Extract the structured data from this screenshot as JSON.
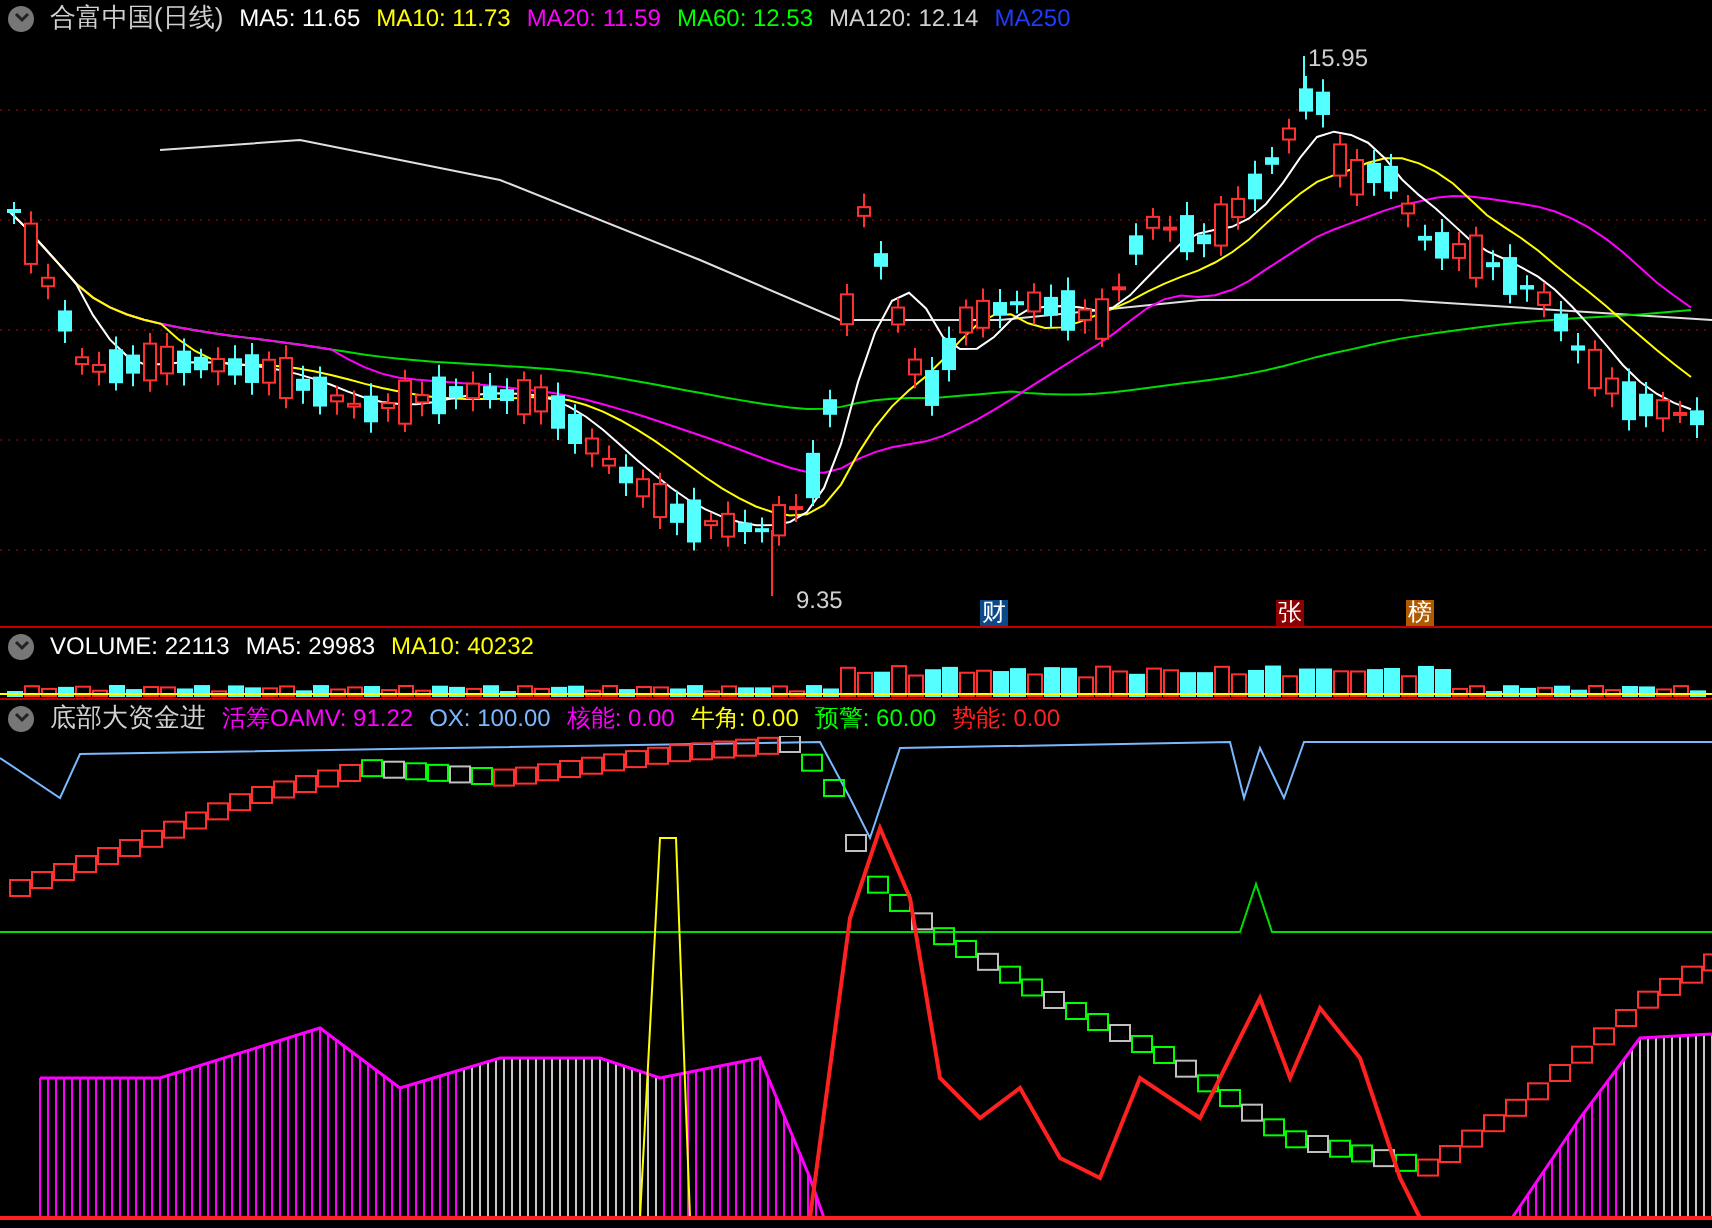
{
  "main": {
    "title": "合富中国(日线)",
    "indicators": [
      {
        "label": "MA5: 11.65",
        "color": "#ffffff"
      },
      {
        "label": "MA10: 11.73",
        "color": "#ffff00"
      },
      {
        "label": "MA20: 11.59",
        "color": "#ff00ff"
      },
      {
        "label": "MA60: 12.53",
        "color": "#00ff00"
      },
      {
        "label": "MA120: 12.14",
        "color": "#d0d0d0"
      },
      {
        "label": "MA250",
        "color": "#1e3cff"
      }
    ],
    "high_label": "15.95",
    "low_label": "9.35",
    "badges": [
      {
        "text": "财",
        "color": "#0b4a8a"
      },
      {
        "text": "张",
        "color": "#8b0000"
      },
      {
        "text": "榜",
        "color": "#b05a00"
      }
    ]
  },
  "volume": {
    "indicators": [
      {
        "label": "VOLUME: 22113",
        "color": "#ffffff"
      },
      {
        "label": "MA5: 29983",
        "color": "#fffffe"
      },
      {
        "label": "MA10: 40232",
        "color": "#ffff00"
      }
    ]
  },
  "indicator": {
    "title": "底部大资金进",
    "values": [
      {
        "label": "活筹OAMV: 91.22",
        "color": "#ff00ff"
      },
      {
        "label": "OX: 100.00",
        "color": "#7ab8ff"
      },
      {
        "label": "核能: 0.00",
        "color": "#ff00fe"
      },
      {
        "label": "牛角: 0.00",
        "color": "#ffff01"
      },
      {
        "label": "预警: 60.00",
        "color": "#00ff00"
      },
      {
        "label": "势能: 0.00",
        "color": "#ff2020"
      }
    ]
  }
}
